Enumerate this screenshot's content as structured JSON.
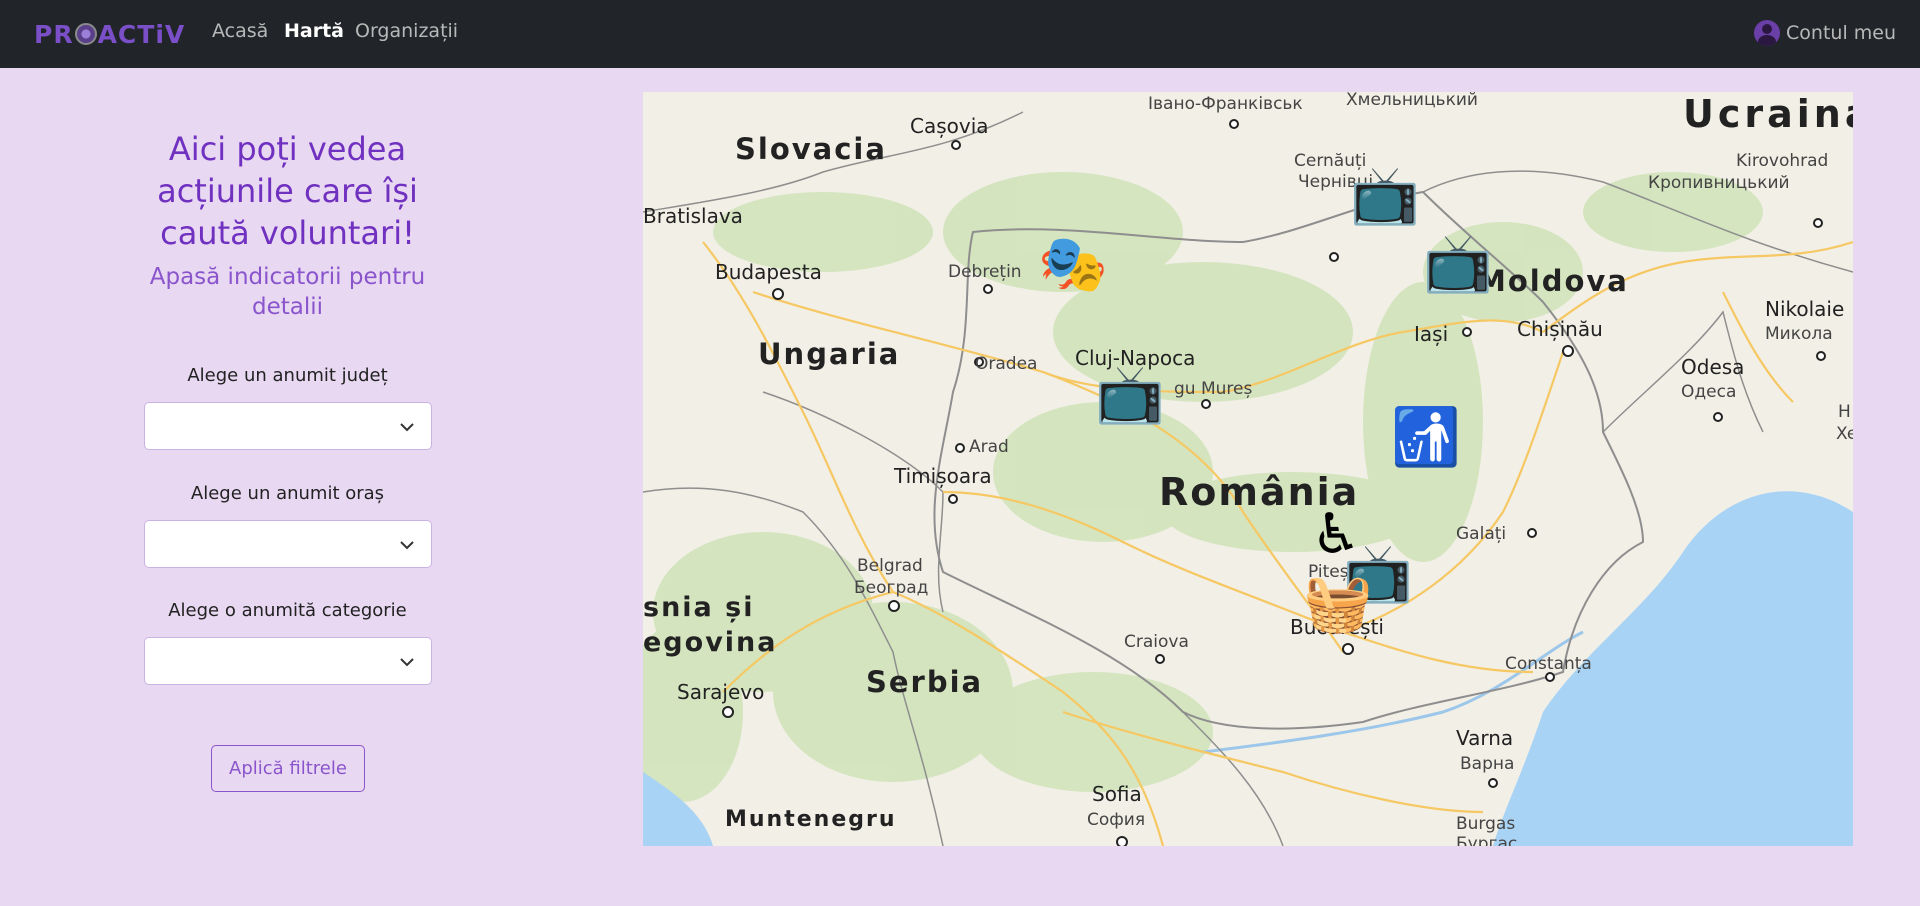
{
  "navbar": {
    "brand_prefix": "PR",
    "brand_suffix": "ACTiV",
    "links": [
      "Acasă",
      "Hartă",
      "Organizații"
    ],
    "account": "Contul meu"
  },
  "panel": {
    "headline": "Aici poți vedea acțiunile care își caută voluntari!",
    "subline": "Apasă indicatorii pentru detalii",
    "filters": [
      {
        "label": "Alege un anumit județ",
        "value": ""
      },
      {
        "label": "Alege un anumit oraș",
        "value": ""
      },
      {
        "label": "Alege o anumită categorie",
        "value": ""
      }
    ],
    "apply": "Aplică filtrele"
  },
  "map": {
    "countries": [
      "Slovacia",
      "Ungaria",
      "România",
      "Moldova",
      "Ucraina",
      "Serbia",
      "Muntenegru",
      "snia și",
      "egovina"
    ],
    "cities": [
      "Cașovia",
      "Bratislava",
      "Budapesta",
      "Debrețin",
      "Oradea",
      "Cluj-Napoca",
      "gu Mureș",
      "Arad",
      "Timișoara",
      "Belgrad",
      "Београд",
      "Sarajevo",
      "Craiova",
      "București",
      "Constanța",
      "Galați",
      "Iași",
      "Chișinău",
      "Cernăuți",
      "Чернівці",
      "Івано-Франківськ",
      "Хмельницький",
      "Kirovohrad",
      "Кропивницький",
      "Nikolaie",
      "Микола",
      "Odesa",
      "Одеса",
      "Varna",
      "Варна",
      "Sofia",
      "София",
      "Burgas",
      "Бургас",
      "Pitești",
      "H",
      "Xe"
    ]
  }
}
